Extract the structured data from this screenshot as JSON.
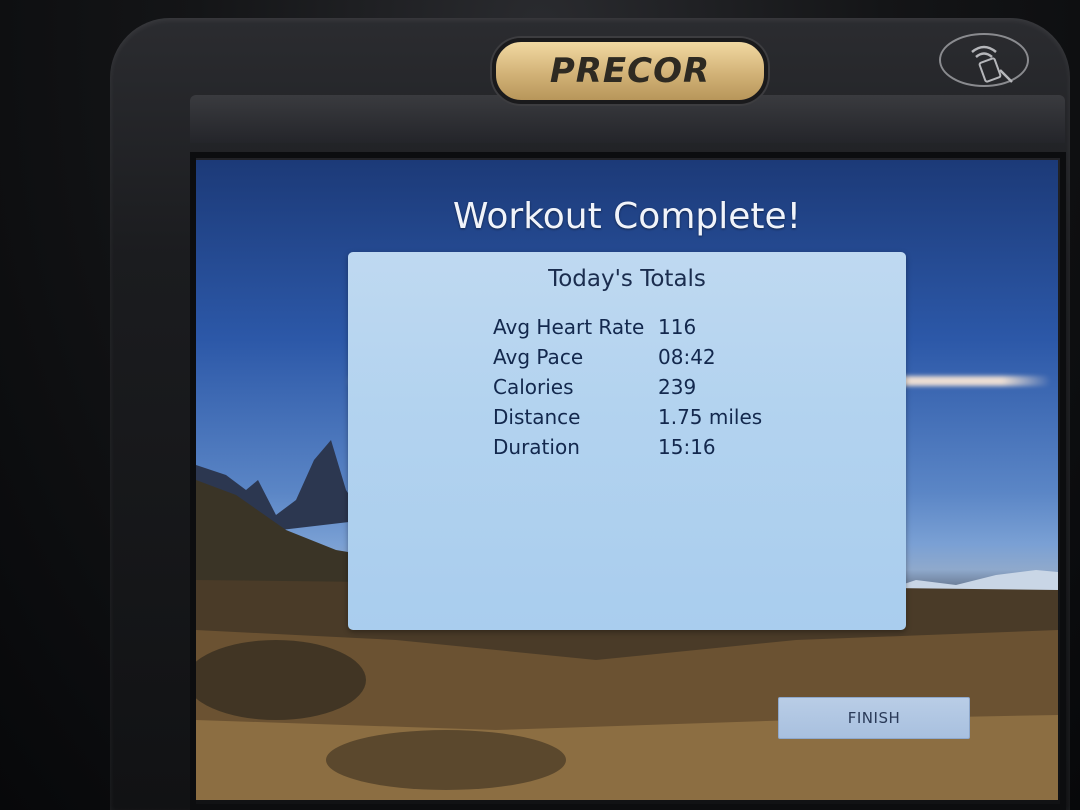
{
  "brand": {
    "name": "PRECOR"
  },
  "icons": {
    "nfc": "contactless-tap-icon"
  },
  "screen": {
    "title": "Workout Complete!",
    "totals": {
      "heading": "Today's Totals",
      "rows": [
        {
          "label": "Avg Heart Rate",
          "value": "116"
        },
        {
          "label": "Avg Pace",
          "value": "08:42"
        },
        {
          "label": "Calories",
          "value": "239"
        },
        {
          "label": "Distance",
          "value": "1.75 miles"
        },
        {
          "label": "Duration",
          "value": "15:16"
        }
      ]
    },
    "finish_label": "FINISH"
  },
  "colors": {
    "brand_gold": "#d2b277",
    "panel_blue": "#b3d3ef",
    "text_navy": "#13284d",
    "button_blue": "#b9cde6"
  }
}
